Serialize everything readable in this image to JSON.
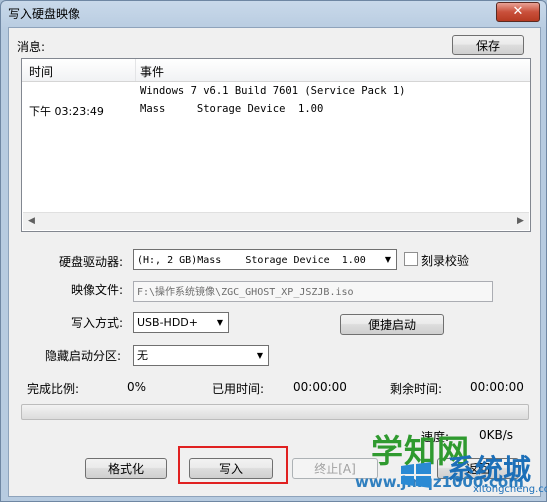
{
  "window": {
    "title": "写入硬盘映像",
    "close_symbol": "✕"
  },
  "messages": {
    "label": "消息:",
    "save_button": "保存",
    "columns": [
      "时间",
      "事件"
    ],
    "rows": [
      {
        "time": "",
        "event": "Windows 7 v6.1 Build 7601 (Service Pack 1)"
      },
      {
        "time": "下午 03:23:49",
        "event": "Mass     Storage Device  1.00"
      }
    ]
  },
  "form": {
    "drive_label": "硬盘驱动器:",
    "drive_value": "(H:, 2 GB)Mass    Storage Device  1.00",
    "verify_label": "刻录校验",
    "image_label": "映像文件:",
    "image_value": "F:\\操作系统镜像\\ZGC_GHOST_XP_JSZJB.iso",
    "method_label": "写入方式:",
    "method_value": "USB-HDD+",
    "quick_boot_button": "便捷启动",
    "hidden_partition_label": "隐藏启动分区:",
    "hidden_partition_value": "无"
  },
  "status": {
    "complete_label": "完成比例:",
    "complete_value": "0%",
    "elapsed_label": "已用时间:",
    "elapsed_value": "00:00:00",
    "remaining_label": "剩余时间:",
    "remaining_value": "00:00:00",
    "progress": 0,
    "speed_label": "速度:",
    "speed_value": "0KB/s"
  },
  "buttons": {
    "format": "格式化",
    "write": "写入",
    "abort": "终止[A]",
    "back": "返回"
  },
  "watermark": {
    "line1": "学知网",
    "line2": "www.jmqz1000.com",
    "line3": "系统城",
    "line4": "xitongcheng.com"
  },
  "colors": {
    "highlight": "#e02020",
    "progress": "#06b025",
    "title_bar": "#b7cbe0"
  }
}
